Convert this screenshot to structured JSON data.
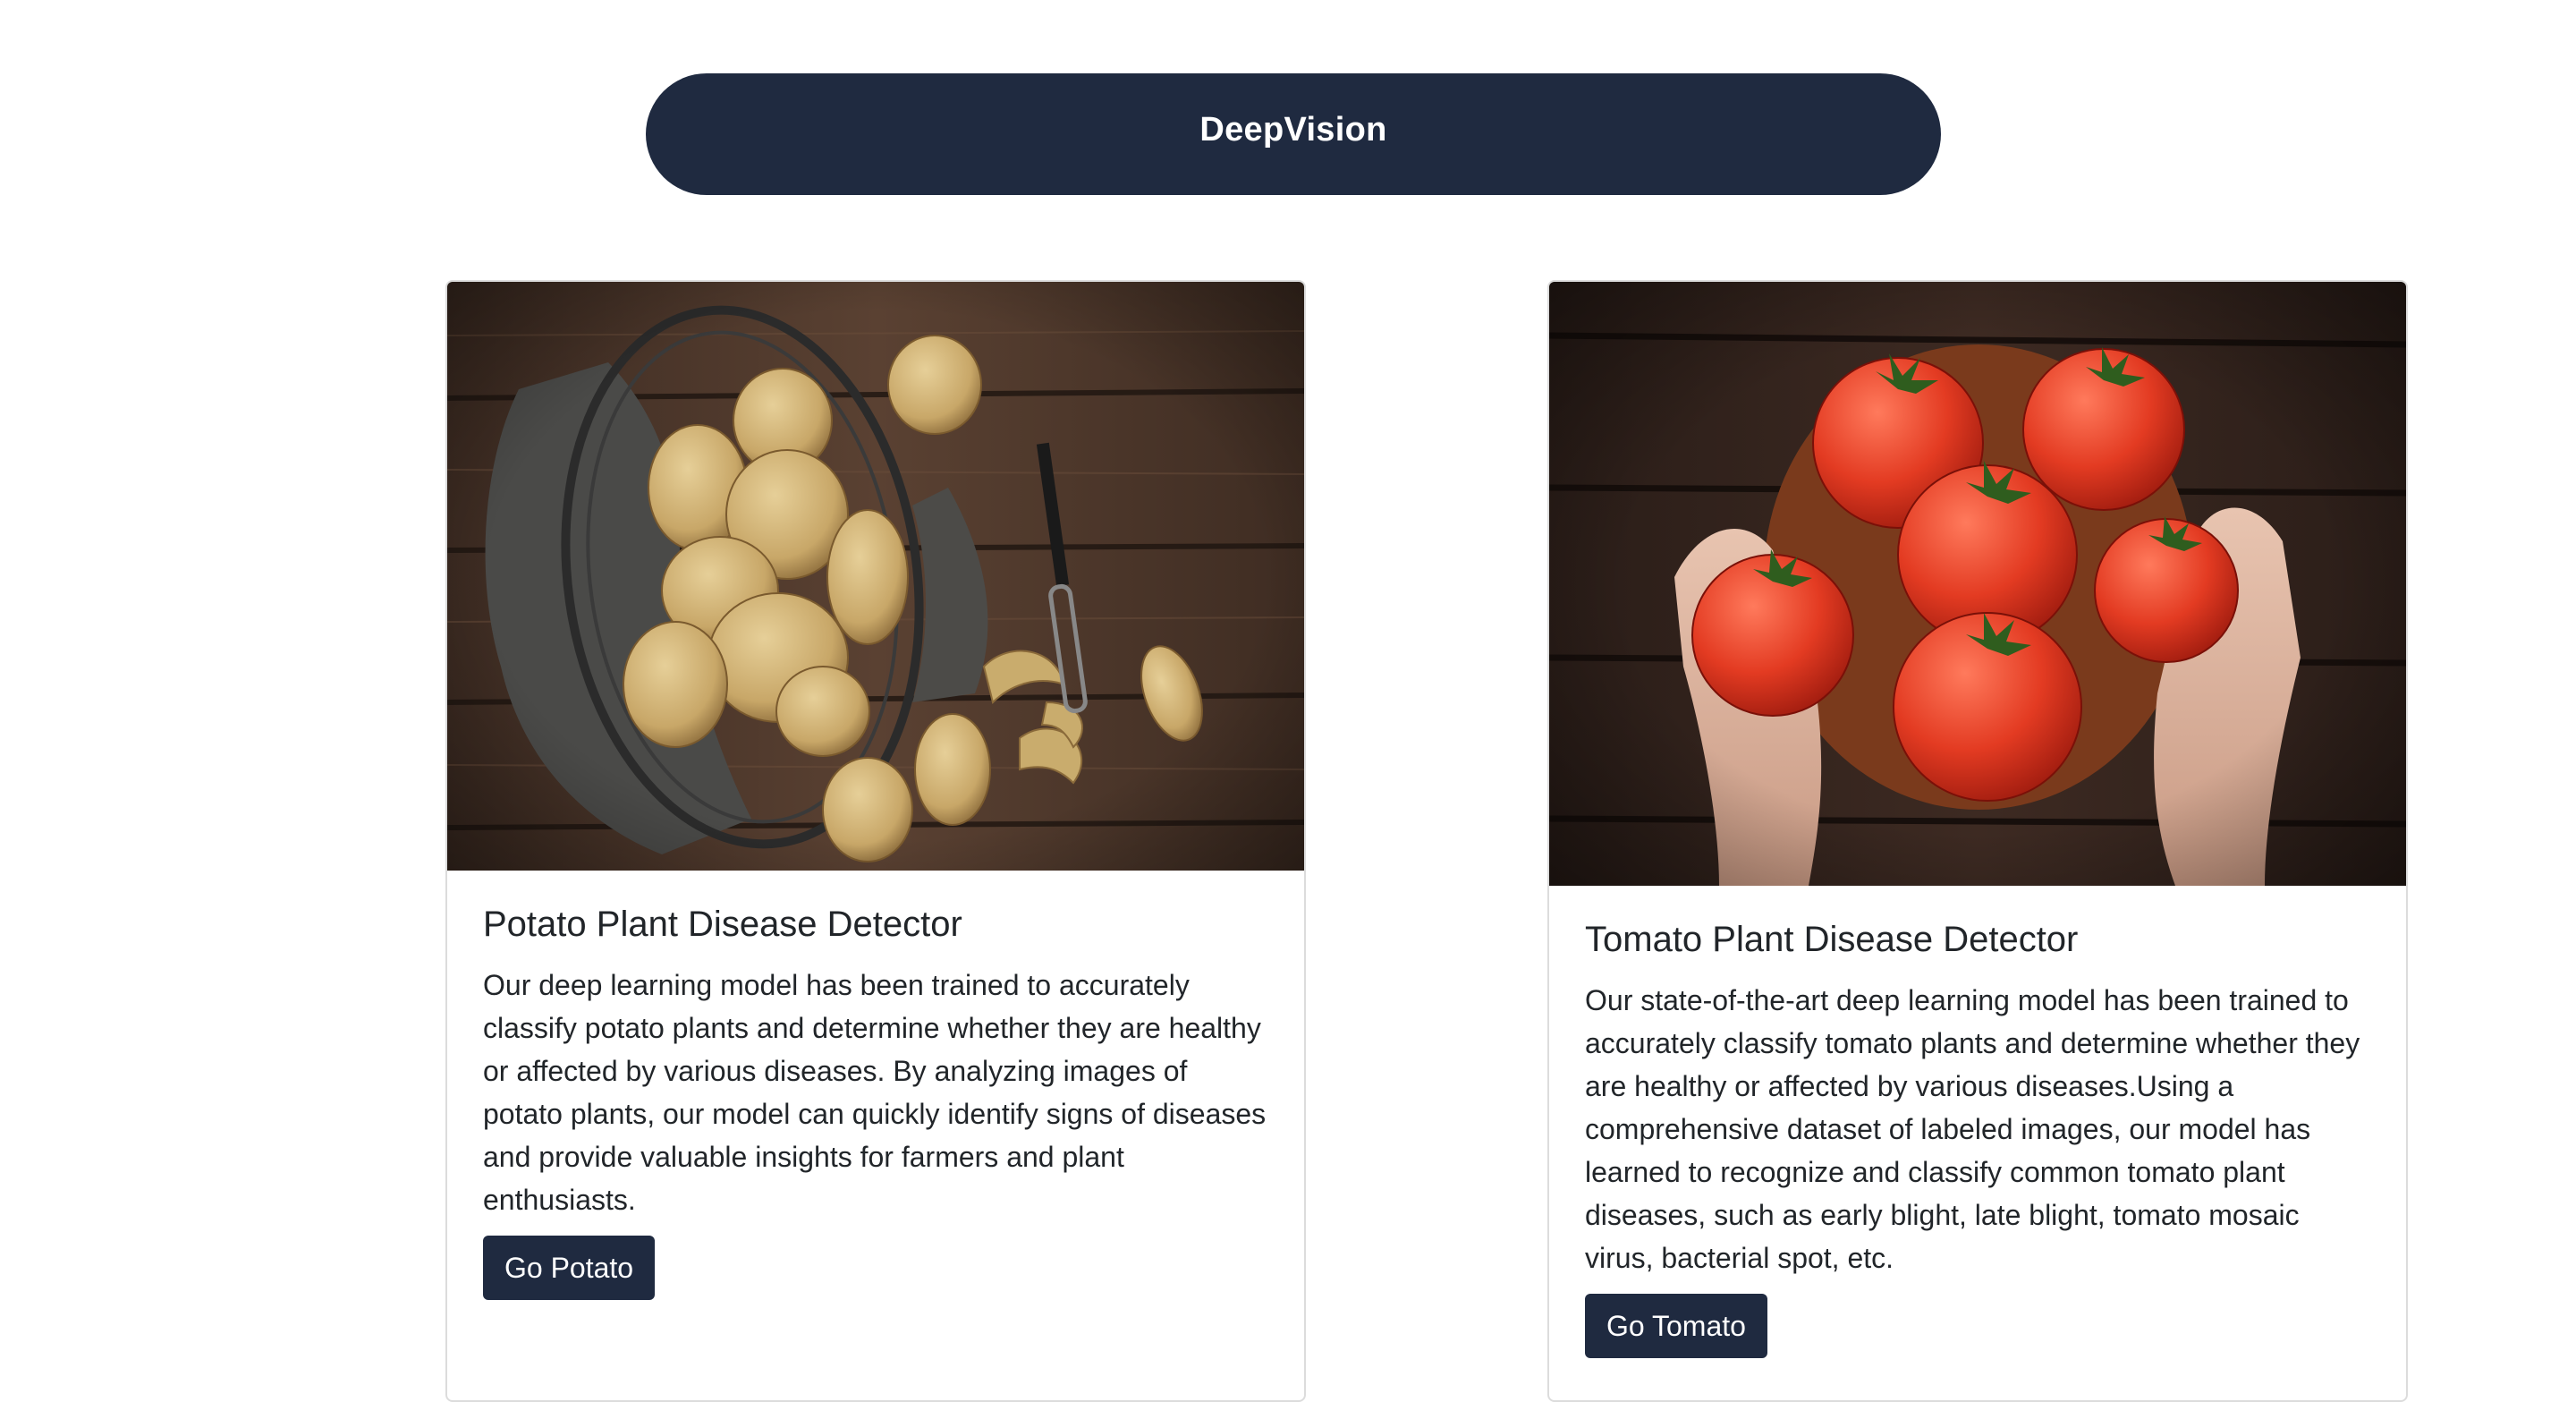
{
  "navbar": {
    "brand": "DeepVision"
  },
  "cards": [
    {
      "title": "Potato Plant Disease Detector",
      "description": "Our deep learning model has been trained to accurately classify potato plants and determine whether they are healthy or affected by various diseases. By analyzing images of potato plants, our model can quickly identify signs of diseases and provide valuable insights for farmers and plant enthusiasts.",
      "button_label": "Go Potato",
      "image": "potatoes-in-wire-basket-photo"
    },
    {
      "title": "Tomato Plant Disease Detector",
      "description": "Our state-of-the-art deep learning model has been trained to accurately classify tomato plants and determine whether they are healthy or affected by various diseases.Using a comprehensive dataset of labeled images, our model has learned to recognize and classify common tomato plant diseases, such as early blight, late blight, tomato mosaic virus, bacterial spot, etc.",
      "button_label": "Go Tomato",
      "image": "hands-holding-tomatoes-photo"
    }
  ],
  "colors": {
    "navbar_bg": "#1f2a40",
    "button_bg": "#1f2a40",
    "text": "#212529",
    "card_border": "#dcdcdc"
  }
}
